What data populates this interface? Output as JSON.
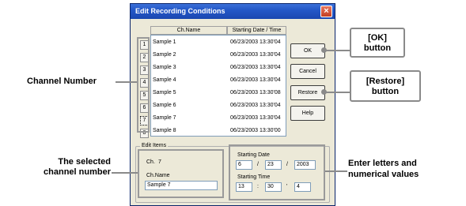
{
  "dialog": {
    "title": "Edit Recording Conditions",
    "close_icon": "close-icon",
    "columns": [
      "Ch.Name",
      "Starting Date / Time"
    ],
    "channels": [
      {
        "num": "1",
        "name": "Sample 1",
        "datetime": "06/23/2003 13:30'04"
      },
      {
        "num": "2",
        "name": "Sample 2",
        "datetime": "06/23/2003 13:30'04"
      },
      {
        "num": "3",
        "name": "Sample 3",
        "datetime": "06/23/2003 13:30'04"
      },
      {
        "num": "4",
        "name": "Sample 4",
        "datetime": "06/23/2003 13:30'04"
      },
      {
        "num": "5",
        "name": "Sample 5",
        "datetime": "06/23/2003 13:30'08"
      },
      {
        "num": "6",
        "name": "Sample 6",
        "datetime": "06/23/2003 13:30'04"
      },
      {
        "num": "7",
        "name": "Sample 7",
        "datetime": "06/23/2003 13:30'04"
      },
      {
        "num": "8",
        "name": "Sample 8",
        "datetime": "06/23/2003 13:30'00"
      }
    ],
    "buttons": {
      "ok": "OK",
      "cancel": "Cancel",
      "restore": "Restore",
      "help": "Help"
    },
    "edit_items": {
      "legend": "Edit Items",
      "ch_label": "Ch.",
      "ch_value": "7",
      "name_label": "Ch.Name",
      "name_value": "Sample 7",
      "date_label": "Starting Date",
      "date_month": "6",
      "date_day": "23",
      "date_year": "2003",
      "date_sep": "/",
      "time_label": "Starting Time",
      "time_hour": "13",
      "time_min": "30",
      "time_sec": "4",
      "time_sep1": ":",
      "time_sep2": "'"
    }
  },
  "callouts": {
    "channel_number": "Channel Number",
    "selected_channel_line1": "The selected",
    "selected_channel_line2": "channel number",
    "ok_line1": "[OK]",
    "ok_line2": "button",
    "restore_line1": "[Restore]",
    "restore_line2": "button",
    "enter_line1": "Enter letters and",
    "enter_line2": "numerical values"
  }
}
